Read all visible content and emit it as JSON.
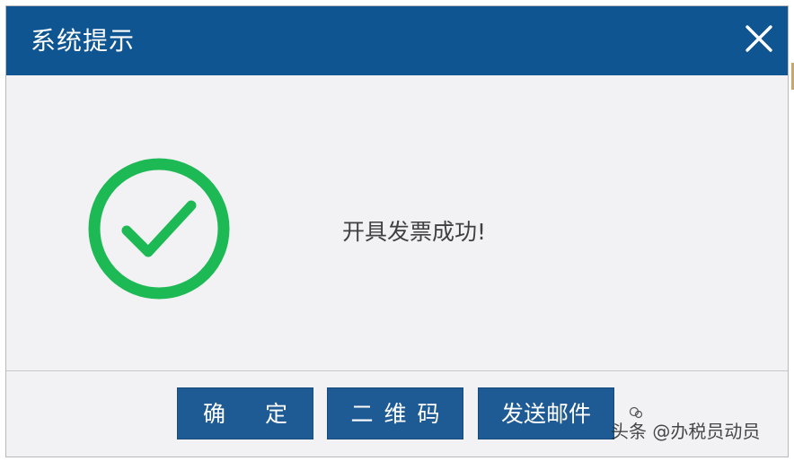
{
  "dialog": {
    "title": "系统提示",
    "message": "开具发票成功!",
    "status_icon": "check-circle-icon",
    "close_icon": "close-icon"
  },
  "buttons": {
    "confirm_label": "确 定",
    "qrcode_label": "二维码",
    "send_email_label": "发送邮件"
  },
  "watermark": {
    "text": "头条 @办税员动员"
  },
  "colors": {
    "titlebar": "#0f5592",
    "button": "#1e5a93",
    "check_green": "#1db954",
    "dialog_bg": "#f2f1f4",
    "message_text": "#404040"
  }
}
